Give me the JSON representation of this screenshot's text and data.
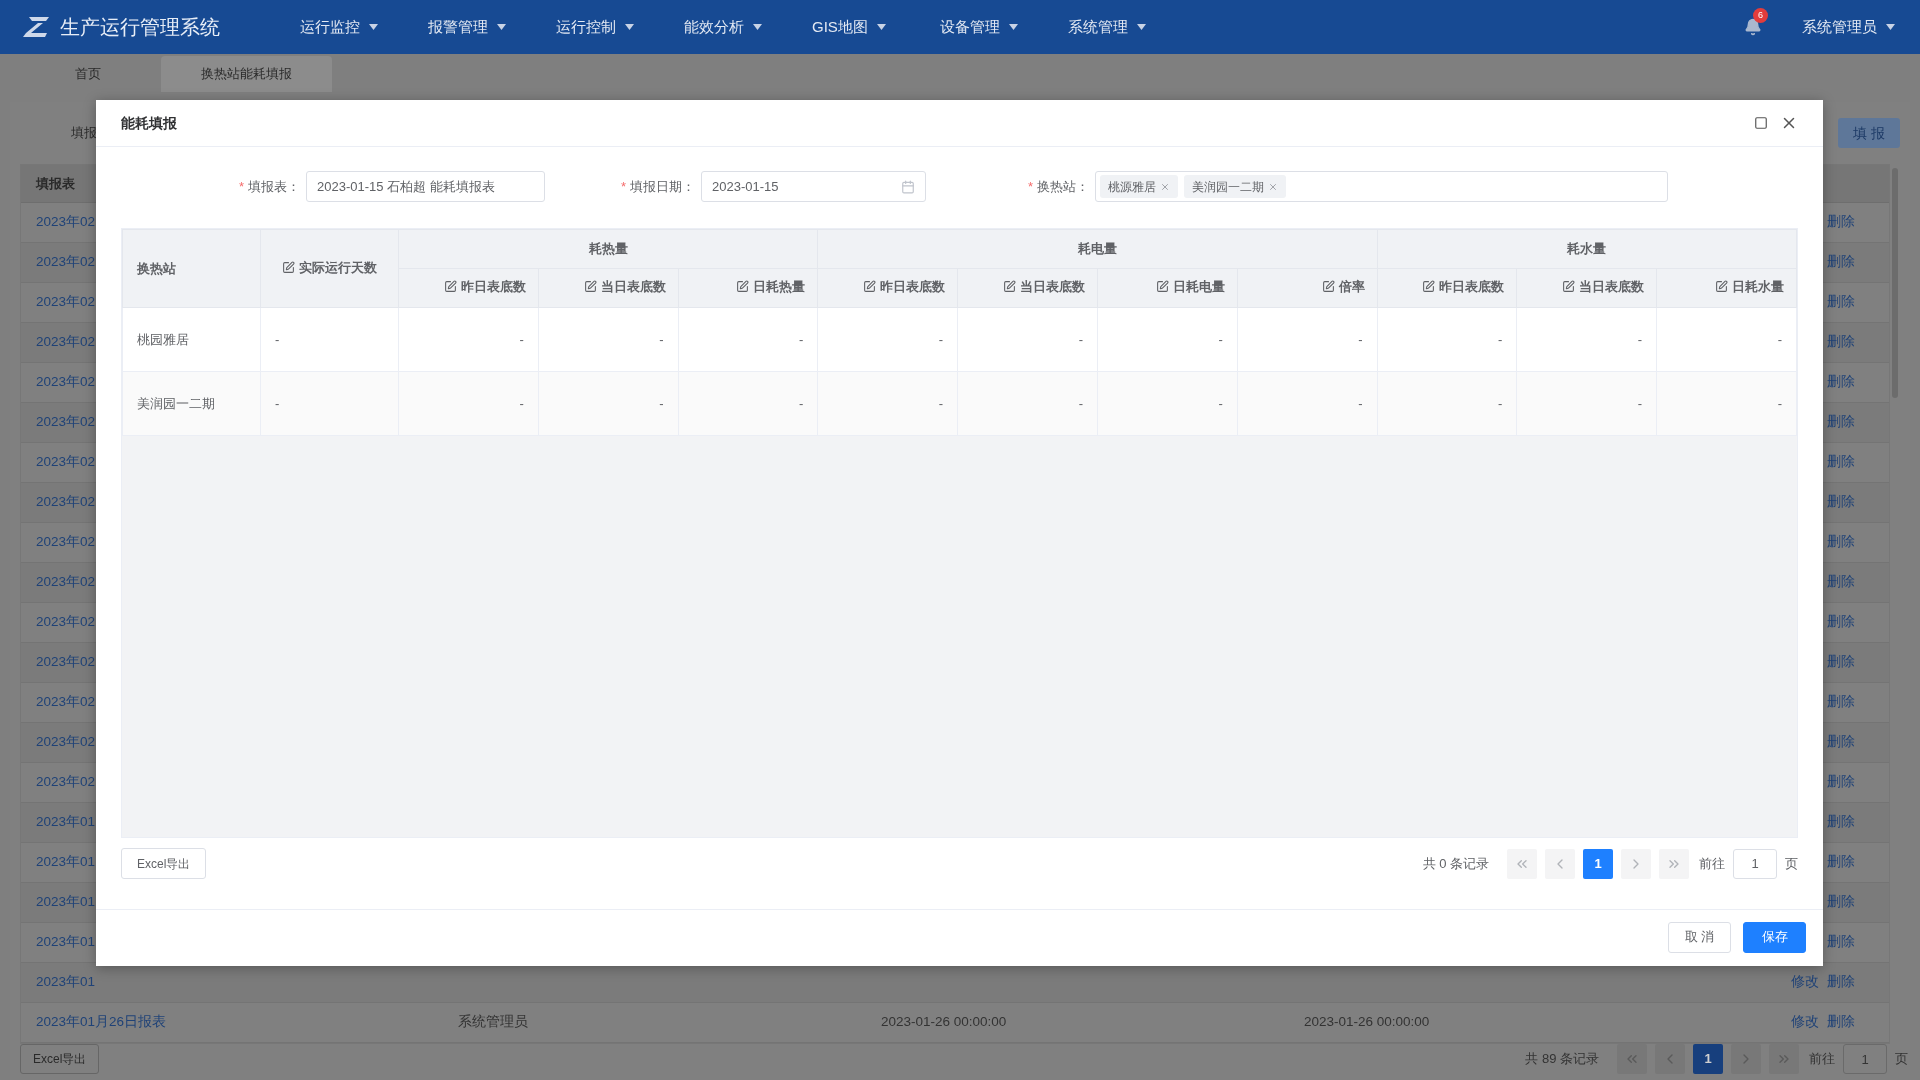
{
  "app": {
    "title": "生产运行管理系统",
    "menus": [
      {
        "label": "运行监控"
      },
      {
        "label": "报警管理"
      },
      {
        "label": "运行控制"
      },
      {
        "label": "能效分析"
      },
      {
        "label": "GIS地图"
      },
      {
        "label": "设备管理"
      },
      {
        "label": "系统管理"
      }
    ],
    "notification_count": "6",
    "user": "系统管理员"
  },
  "tabs": [
    {
      "label": "首页",
      "selected": false
    },
    {
      "label": "换热站能耗填报",
      "selected": true
    }
  ],
  "background": {
    "toolbar_label": "填报",
    "fill_button": "填 报",
    "table": {
      "header": "填报表",
      "rows": [
        {
          "cells": [
            "2023年02"
          ],
          "actions": [
            "删除"
          ]
        },
        {
          "cells": [
            "2023年02"
          ],
          "actions": [
            "删除"
          ]
        },
        {
          "cells": [
            "2023年02"
          ],
          "actions": [
            "删除"
          ]
        },
        {
          "cells": [
            "2023年02"
          ],
          "actions": [
            "删除"
          ]
        },
        {
          "cells": [
            "2023年02"
          ],
          "actions": [
            "删除"
          ]
        },
        {
          "cells": [
            "2023年02"
          ],
          "actions": [
            "删除"
          ]
        },
        {
          "cells": [
            "2023年02"
          ],
          "actions": [
            "删除"
          ]
        },
        {
          "cells": [
            "2023年02"
          ],
          "actions": [
            "删除"
          ]
        },
        {
          "cells": [
            "2023年02"
          ],
          "actions": [
            "删除"
          ]
        },
        {
          "cells": [
            "2023年02"
          ],
          "actions": [
            "删除"
          ]
        },
        {
          "cells": [
            "2023年02"
          ],
          "actions": [
            "删除"
          ]
        },
        {
          "cells": [
            "2023年02"
          ],
          "actions": [
            "删除"
          ]
        },
        {
          "cells": [
            "2023年02"
          ],
          "actions": [
            "删除"
          ]
        },
        {
          "cells": [
            "2023年02"
          ],
          "actions": [
            "删除"
          ]
        },
        {
          "cells": [
            "2023年02"
          ],
          "actions": [
            "删除"
          ]
        },
        {
          "cells": [
            "2023年01"
          ],
          "actions": [
            "删除"
          ]
        },
        {
          "cells": [
            "2023年01"
          ],
          "actions": [
            "删除"
          ]
        },
        {
          "cells": [
            "2023年01"
          ],
          "actions": [
            "删除"
          ]
        },
        {
          "cells": [
            "2023年01"
          ],
          "actions": [
            "删除"
          ]
        },
        {
          "cells": [
            "2023年01"
          ],
          "actions": [
            "修改",
            "删除"
          ]
        },
        {
          "cells": [
            "2023年01月26日报表",
            "系统管理员",
            "2023-01-26 00:00:00",
            "2023-01-26 00:00:00"
          ],
          "actions": [
            "修改",
            "删除"
          ]
        }
      ]
    },
    "export_button": "Excel导出",
    "pagination": {
      "total": "共 89 条记录",
      "pages": [
        {
          "label": "1",
          "selected": true
        }
      ],
      "goto_label": "前往",
      "goto_value": "1",
      "page_suffix": "页"
    }
  },
  "dialog": {
    "title": "能耗填报",
    "form": [
      {
        "kind": "text",
        "required_mark": "*",
        "label": "填报表：",
        "value": "2023-01-15 石柏超 能耗填报表"
      },
      {
        "kind": "date",
        "required_mark": "*",
        "label": "填报日期：",
        "value": "2023-01-15"
      },
      {
        "kind": "tags",
        "required_mark": "*",
        "label": "换热站：",
        "tags": [
          {
            "label": "桃源雅居"
          },
          {
            "label": "美润园一二期"
          }
        ]
      }
    ],
    "table": {
      "station_header": "换热站",
      "days_header": "实际运行天数",
      "groups": [
        {
          "label": "耗热量",
          "columns": [
            "昨日表底数",
            "当日表底数",
            "日耗热量"
          ]
        },
        {
          "label": "耗电量",
          "columns": [
            "昨日表底数",
            "当日表底数",
            "日耗电量",
            "倍率"
          ]
        },
        {
          "label": "耗水量",
          "columns": [
            "昨日表底数",
            "当日表底数",
            "日耗水量"
          ]
        }
      ],
      "rows": [
        {
          "station": "桃园雅居",
          "days": "-",
          "values": [
            "-",
            "-",
            "-",
            "-",
            "-",
            "-",
            "-",
            "-",
            "-",
            "-"
          ]
        },
        {
          "station": "美润园一二期",
          "days": "-",
          "values": [
            "-",
            "-",
            "-",
            "-",
            "-",
            "-",
            "-",
            "-",
            "-",
            "-"
          ]
        }
      ]
    },
    "export_button": "Excel导出",
    "pagination": {
      "total": "共 0 条记录",
      "pages": [
        {
          "label": "1",
          "selected": true
        }
      ],
      "goto_label": "前往",
      "goto_value": "1",
      "page_suffix": "页"
    },
    "buttons": [
      {
        "kind": "secondary",
        "label": "取 消"
      },
      {
        "kind": "primary",
        "label": "保存"
      }
    ]
  }
}
